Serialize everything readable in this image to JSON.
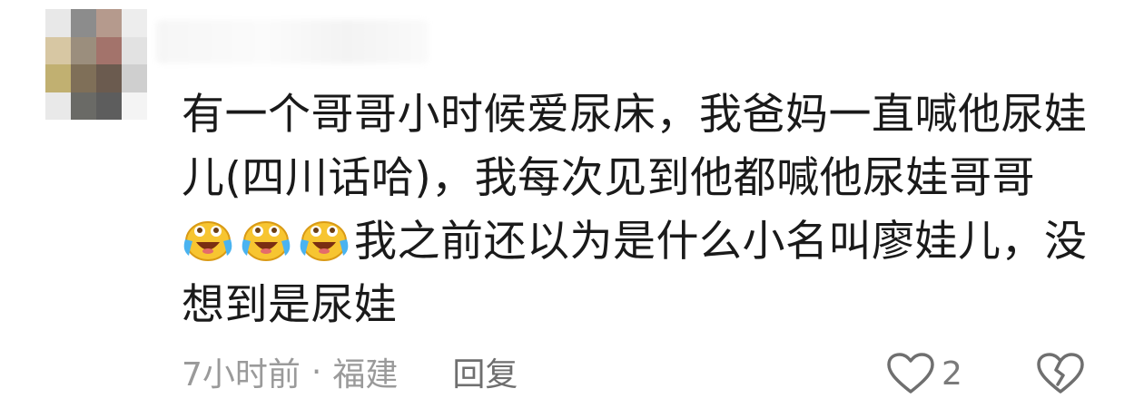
{
  "comment": {
    "text_part1": "有一个哥哥小时候爱尿床，我爸妈一直喊他尿娃儿(四川话哈)，我每次见到他都喊他尿娃哥哥",
    "emojis": [
      "crying-laughing-emoji",
      "crying-laughing-emoji",
      "crying-laughing-emoji"
    ],
    "text_part2": "我之前还以为是什么小名叫廖娃儿，没想到是尿娃"
  },
  "meta": {
    "time": "7小时前",
    "separator": "·",
    "location": "福建",
    "reply_label": "回复"
  },
  "actions": {
    "like_icon": "heart-icon",
    "like_count": "2",
    "dislike_icon": "broken-heart-icon"
  }
}
